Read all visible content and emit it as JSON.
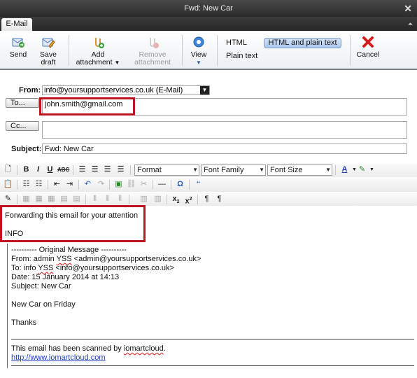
{
  "window": {
    "title": "Fwd: New Car",
    "close_icon": "close-icon"
  },
  "tab": {
    "label": "E-Mail"
  },
  "ribbon": {
    "send": "Send",
    "save_line1": "Save",
    "save_line2": "draft",
    "add_line1": "Add",
    "add_line2": "attachment",
    "remove_line1": "Remove",
    "remove_line2": "attachment",
    "view": "View",
    "format_html": "HTML",
    "format_html_plain": "HTML and plain text",
    "format_plain": "Plain text",
    "cancel": "Cancel"
  },
  "header": {
    "from_label": "From:",
    "from_value": "info@yoursupportservices.co.uk (E-Mail)",
    "to_button": "To...",
    "to_value": "john.smith@gmail.com",
    "cc_button": "Cc...",
    "cc_value": "",
    "subject_label": "Subject:",
    "subject_value": "Fwd: New Car"
  },
  "toolbar": {
    "format_combo": "Format",
    "font_family_combo": "Font Family",
    "font_size_combo": "Font Size"
  },
  "body": {
    "line1": "Forwarding this email for your attention",
    "line2": "INFO",
    "orig_header": "---------- Original Message ----------",
    "from_prefix": "From: admin ",
    "from_yss": "YSS",
    "from_rest": " <admin@yoursupportservices.co.uk>",
    "to_prefix": "To: info ",
    "to_yss": "YSS",
    "to_rest": " <info@yoursupportservices.co.uk>",
    "date": "Date: 15 January 2014 at 14:13",
    "subject": "Subject: New Car",
    "msg": "New Car on Friday",
    "thanks": "Thanks",
    "scanned_prefix": "This email has been scanned by ",
    "scanned_brand": "iomartcloud",
    "scanned_suffix": ".",
    "url": "http://www.iomartcloud.com"
  },
  "colors": {
    "highlight_box": "#c0141e",
    "link": "#1f3fbf",
    "selected_format": "#a9c6ee"
  }
}
